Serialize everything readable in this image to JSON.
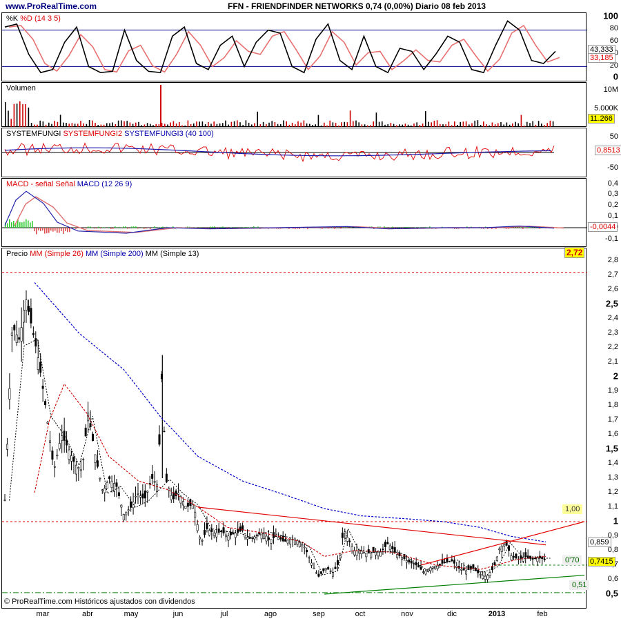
{
  "header": {
    "site": "www.ProRealTime.com",
    "title": "FFN - FRIENDFINDER NETWORKS    0,74 (0,00%)    Diario  08 feb 2013"
  },
  "footer": "© ProRealTime.com  Históricos ajustados con dividendos",
  "months": [
    "mar",
    "abr",
    "may",
    "jun",
    "jul",
    "ago",
    "sep",
    "oct",
    "nov",
    "dic",
    "2013",
    "feb"
  ],
  "panels": {
    "stoch": {
      "title_k": "%K",
      "title_d": "%D",
      "title_params": "(14 3 5)",
      "ticks": [
        "100",
        "80",
        "60",
        "40",
        "20",
        "0"
      ],
      "tag_k": "43,333",
      "tag_d": "33,185"
    },
    "volume": {
      "title": "Volumen",
      "ticks": [
        "10M",
        "5.000K"
      ],
      "tag": "11.266"
    },
    "fungi": {
      "title_1": "SYSTEMFUNGI",
      "title_2": "SYSTEMFUNGI2",
      "title_3": "SYSTEMFUNGI3",
      "title_params": "(40 100)",
      "ticks": [
        "50",
        "0",
        "-50"
      ],
      "tag": "0,8513"
    },
    "macd": {
      "title_1": "MACD",
      "title_2": "- señal",
      "title_3": "Señal",
      "title_4": "MACD",
      "title_params": "(12 26 9)",
      "ticks": [
        "0,4",
        "0,3",
        "0,2",
        "0,1",
        "0",
        "-0,1"
      ],
      "tag": "-0,0044"
    },
    "price": {
      "title_1": "Precio",
      "title_2": "MM",
      "title_3": "(Simple 26)",
      "title_4": "MM",
      "title_5": "(Simple 200)",
      "title_6": "MM (Simple 13)",
      "tag_high": "2,72",
      "tag_one": "1,00",
      "tag_0859": "0,859",
      "tag_last": "0,7415",
      "label_070": "0'70",
      "label_051": "0,51"
    }
  },
  "chart_data": {
    "type": "candlestick",
    "title": "FFN - FRIENDFINDER NETWORKS",
    "last_price": 0.74,
    "change_pct": "0,00%",
    "period": "Diario",
    "date": "08 feb 2013",
    "x_labels": [
      "mar",
      "abr",
      "may",
      "jun",
      "jul",
      "ago",
      "sep",
      "oct",
      "nov",
      "dic",
      "2013",
      "feb"
    ],
    "price_axis": {
      "ylim": [
        0.5,
        2.8
      ],
      "ticks": [
        "2,8",
        "2,7",
        "2,6",
        "2,5",
        "2,4",
        "2,3",
        "2,2",
        "2,1",
        "2",
        "1,9",
        "1,8",
        "1,7",
        "1,6",
        "1,5",
        "1,4",
        "1,3",
        "1,2",
        "1,1",
        "1",
        "0,9",
        "0,8",
        "0,7",
        "0,6",
        "0,5"
      ],
      "bold_ticks": [
        "2,5",
        "2",
        "1,5",
        "1",
        "0,5"
      ]
    },
    "price_series": [
      {
        "x": 0,
        "close": 1.15
      },
      {
        "x": 5,
        "close": 2.35
      },
      {
        "x": 10,
        "close": 2.25
      },
      {
        "x": 14,
        "close": 2.55
      },
      {
        "x": 19,
        "close": 2.3
      },
      {
        "x": 23,
        "close": 2.1
      },
      {
        "x": 28,
        "close": 1.75
      },
      {
        "x": 33,
        "close": 1.35
      },
      {
        "x": 38,
        "close": 1.6
      },
      {
        "x": 43,
        "close": 1.5
      },
      {
        "x": 47,
        "close": 1.4
      },
      {
        "x": 52,
        "close": 1.35
      },
      {
        "x": 56,
        "close": 1.75
      },
      {
        "x": 61,
        "close": 1.45
      },
      {
        "x": 66,
        "close": 1.2
      },
      {
        "x": 70,
        "close": 1.3
      },
      {
        "x": 75,
        "close": 1.25
      },
      {
        "x": 80,
        "close": 1.05
      },
      {
        "x": 85,
        "close": 1.1
      },
      {
        "x": 89,
        "close": 1.2
      },
      {
        "x": 94,
        "close": 1.15
      },
      {
        "x": 99,
        "close": 1.3
      },
      {
        "x": 103,
        "close": 1.25
      },
      {
        "x": 106,
        "close": 2.1
      },
      {
        "x": 108,
        "close": 1.3
      },
      {
        "x": 113,
        "close": 1.15
      },
      {
        "x": 117,
        "close": 1.2
      },
      {
        "x": 122,
        "close": 1.1
      },
      {
        "x": 127,
        "close": 1.12
      },
      {
        "x": 132,
        "close": 0.85
      },
      {
        "x": 136,
        "close": 0.95
      },
      {
        "x": 141,
        "close": 0.92
      },
      {
        "x": 146,
        "close": 0.93
      },
      {
        "x": 150,
        "close": 0.9
      },
      {
        "x": 155,
        "close": 0.92
      },
      {
        "x": 160,
        "close": 0.94
      },
      {
        "x": 164,
        "close": 0.88
      },
      {
        "x": 169,
        "close": 0.9
      },
      {
        "x": 174,
        "close": 0.93
      },
      {
        "x": 178,
        "close": 0.87
      },
      {
        "x": 183,
        "close": 0.9
      },
      {
        "x": 188,
        "close": 0.86
      },
      {
        "x": 192,
        "close": 0.88
      },
      {
        "x": 197,
        "close": 0.87
      },
      {
        "x": 202,
        "close": 0.82
      },
      {
        "x": 207,
        "close": 0.7
      },
      {
        "x": 211,
        "close": 0.62
      },
      {
        "x": 216,
        "close": 0.68
      },
      {
        "x": 221,
        "close": 0.65
      },
      {
        "x": 225,
        "close": 0.72
      },
      {
        "x": 228,
        "close": 0.95
      },
      {
        "x": 230,
        "close": 0.9
      },
      {
        "x": 235,
        "close": 0.8
      },
      {
        "x": 239,
        "close": 0.8
      },
      {
        "x": 244,
        "close": 0.78
      },
      {
        "x": 249,
        "close": 0.79
      },
      {
        "x": 253,
        "close": 0.79
      },
      {
        "x": 258,
        "close": 0.85
      },
      {
        "x": 263,
        "close": 0.78
      },
      {
        "x": 268,
        "close": 0.75
      },
      {
        "x": 272,
        "close": 0.72
      },
      {
        "x": 277,
        "close": 0.7
      },
      {
        "x": 282,
        "close": 0.65
      },
      {
        "x": 286,
        "close": 0.68
      },
      {
        "x": 291,
        "close": 0.7
      },
      {
        "x": 296,
        "close": 0.72
      },
      {
        "x": 301,
        "close": 0.73
      },
      {
        "x": 305,
        "close": 0.68
      },
      {
        "x": 310,
        "close": 0.66
      },
      {
        "x": 315,
        "close": 0.68
      },
      {
        "x": 319,
        "close": 0.64
      },
      {
        "x": 324,
        "close": 0.62
      },
      {
        "x": 329,
        "close": 0.68
      },
      {
        "x": 333,
        "close": 0.82
      },
      {
        "x": 337,
        "close": 0.85
      },
      {
        "x": 341,
        "close": 0.76
      },
      {
        "x": 346,
        "close": 0.74
      },
      {
        "x": 350,
        "close": 0.76
      },
      {
        "x": 355,
        "close": 0.74
      },
      {
        "x": 359,
        "close": 0.75
      },
      {
        "x": 364,
        "close": 0.74
      }
    ],
    "sma200_approx": [
      {
        "x": 20,
        "v": 2.65
      },
      {
        "x": 50,
        "v": 2.3
      },
      {
        "x": 80,
        "v": 2.05
      },
      {
        "x": 105,
        "v": 1.72
      },
      {
        "x": 130,
        "v": 1.45
      },
      {
        "x": 160,
        "v": 1.28
      },
      {
        "x": 190,
        "v": 1.18
      },
      {
        "x": 215,
        "v": 1.09
      },
      {
        "x": 240,
        "v": 1.04
      },
      {
        "x": 270,
        "v": 1.02
      },
      {
        "x": 295,
        "v": 1.0
      },
      {
        "x": 320,
        "v": 0.96
      },
      {
        "x": 340,
        "v": 0.9
      },
      {
        "x": 364,
        "v": 0.86
      }
    ],
    "sma26_approx": [
      {
        "x": 20,
        "v": 1.2
      },
      {
        "x": 30,
        "v": 1.7
      },
      {
        "x": 40,
        "v": 1.95
      },
      {
        "x": 55,
        "v": 1.75
      },
      {
        "x": 70,
        "v": 1.45
      },
      {
        "x": 90,
        "v": 1.28
      },
      {
        "x": 110,
        "v": 1.22
      },
      {
        "x": 130,
        "v": 1.1
      },
      {
        "x": 150,
        "v": 0.96
      },
      {
        "x": 175,
        "v": 0.92
      },
      {
        "x": 200,
        "v": 0.86
      },
      {
        "x": 215,
        "v": 0.76
      },
      {
        "x": 235,
        "v": 0.8
      },
      {
        "x": 260,
        "v": 0.79
      },
      {
        "x": 290,
        "v": 0.7
      },
      {
        "x": 320,
        "v": 0.67
      },
      {
        "x": 345,
        "v": 0.74
      },
      {
        "x": 364,
        "v": 0.76
      }
    ],
    "trendlines": [
      {
        "from": {
          "x": 130,
          "v": 1.1
        },
        "to": {
          "x": 364,
          "v": 0.84
        },
        "color": "#e00000"
      },
      {
        "from": {
          "x": 280,
          "v": 0.7
        },
        "to": {
          "x": 390,
          "v": 1.0
        },
        "color": "#e00000"
      },
      {
        "from": {
          "x": 215,
          "v": 0.5
        },
        "to": {
          "x": 390,
          "v": 0.63
        },
        "color": "#008000"
      }
    ],
    "levels": [
      2.72,
      1.0,
      0.7,
      0.51
    ],
    "volume": {
      "max_spike": "10M",
      "last": "11.266"
    },
    "stoch": {
      "k": 43.333,
      "d": 33.185,
      "bands": [
        20,
        80
      ]
    },
    "fungi": {
      "last": 0.8513
    },
    "macd": {
      "last": -0.0044
    }
  }
}
